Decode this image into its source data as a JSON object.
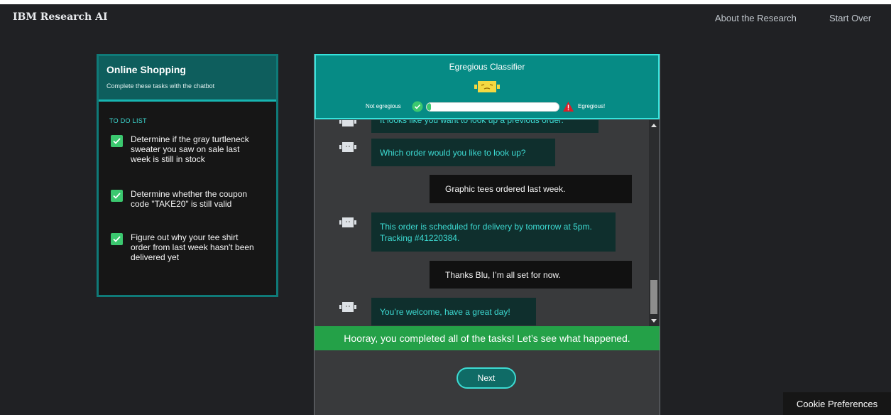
{
  "header": {
    "brand": "IBM Research AI",
    "nav": {
      "about": "About the Research",
      "start_over": "Start Over"
    }
  },
  "task_panel": {
    "title": "Online Shopping",
    "subtitle": "Complete these tasks with the chatbot",
    "todo_label": "TO DO LIST",
    "items": [
      {
        "text": "Determine if the gray turtleneck sweater you saw on sale last week is still in stock",
        "done": true
      },
      {
        "text": "Determine whether the coupon code \"TAKE20\" is still valid",
        "done": true
      },
      {
        "text": "Figure out why your tee shirt order from last week hasn't been delivered yet",
        "done": true
      }
    ]
  },
  "classifier": {
    "title": "Egregious Classifier",
    "left_label": "Not egregious",
    "right_label": "Egregious!",
    "level": 0.03
  },
  "chat": {
    "messages": [
      {
        "from": "bot",
        "text": "It looks like you want to look up a previous order."
      },
      {
        "from": "bot",
        "text": "Which order would you like to look up?"
      },
      {
        "from": "user",
        "text": "Graphic tees ordered last week."
      },
      {
        "from": "bot",
        "text": "This order is scheduled for delivery by tomorrow at 5pm. Tracking #41220384."
      },
      {
        "from": "user",
        "text": "Thanks Blu, I’m all set for now."
      },
      {
        "from": "bot",
        "text": "You’re welcome, have a great day!"
      }
    ]
  },
  "completion_banner": "Hooray, you completed all of the tasks! Let’s see what happened.",
  "next_button": "Next",
  "cookie_button": "Cookie Preferences",
  "colors": {
    "teal_accent": "#3ddbd3",
    "classifier_bg": "#068b85",
    "success_green": "#24a148",
    "check_green": "#3bc86f",
    "warning_red": "#da1e28"
  },
  "icons": [
    "check-icon",
    "bot-avatar-icon",
    "ok-circle-icon",
    "warning-triangle-icon",
    "scroll-up-icon",
    "scroll-down-icon"
  ]
}
